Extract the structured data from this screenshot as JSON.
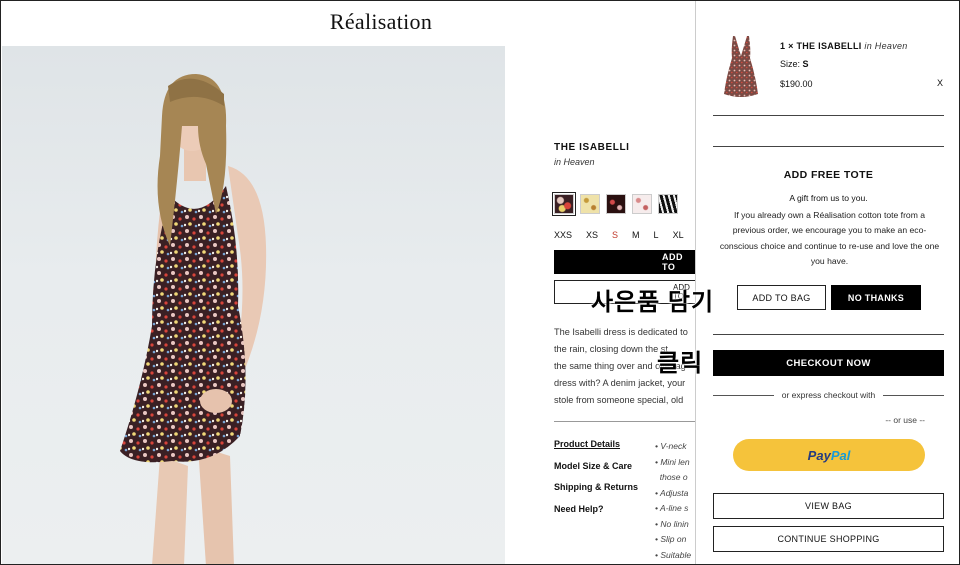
{
  "brand": {
    "logo": "Réalisation"
  },
  "product": {
    "name": "THE ISABELLI",
    "variant": "in Heaven",
    "swatches": [
      {
        "color": "#7a2a2a",
        "selected": true
      },
      {
        "color": "#e8d99b",
        "selected": false
      },
      {
        "color": "#2a1010",
        "selected": false
      },
      {
        "color": "#f2e2e2",
        "selected": false
      },
      {
        "color": "#1a1a1a",
        "selected": false
      }
    ],
    "sizes": [
      "XXS",
      "XS",
      "S",
      "M",
      "L",
      "XL"
    ],
    "selected_size": "S",
    "add_to_bag_label": "ADD TO",
    "add_to_bag_secondary_label": "ADD TO",
    "description": [
      "The Isabelli dress is dedicated to",
      "the rain, closing down the st",
      "the same thing over and over ag",
      "dress with? A denim jacket, your",
      "stole from someone special, old"
    ],
    "detail_links": [
      "Product Details",
      "Model Size & Care",
      "Shipping & Returns",
      "Need Help?"
    ],
    "bullets": [
      "V-neck",
      "Mini len",
      "those o",
      "Adjusta",
      "A-line s",
      "No linin",
      "Slip on",
      "Suitable"
    ]
  },
  "overlay": {
    "line1": "사은품 담기",
    "line2": "클릭"
  },
  "cart": {
    "item": {
      "qty_name": "1 × THE ISABELLI",
      "variant": "in Heaven",
      "size_label": "Size:",
      "size_value": "S",
      "price": "$190.00",
      "remove": "X"
    },
    "tote": {
      "title": "ADD FREE TOTE",
      "gift_line": "A gift from us to you.",
      "body": "If you already own a Réalisation cotton tote from a previous order, we encourage you to make an eco-conscious choice and continue to re-use and love the one you have.",
      "add_label": "ADD TO BAG",
      "no_label": "NO THANKS"
    },
    "checkout_label": "CHECKOUT NOW",
    "express_label": "or express checkout with",
    "or_use_label": "-- or use --",
    "paypal": {
      "part1": "Pay",
      "part2": "Pal"
    },
    "view_bag_label": "VIEW BAG",
    "continue_label": "CONTINUE SHOPPING"
  }
}
